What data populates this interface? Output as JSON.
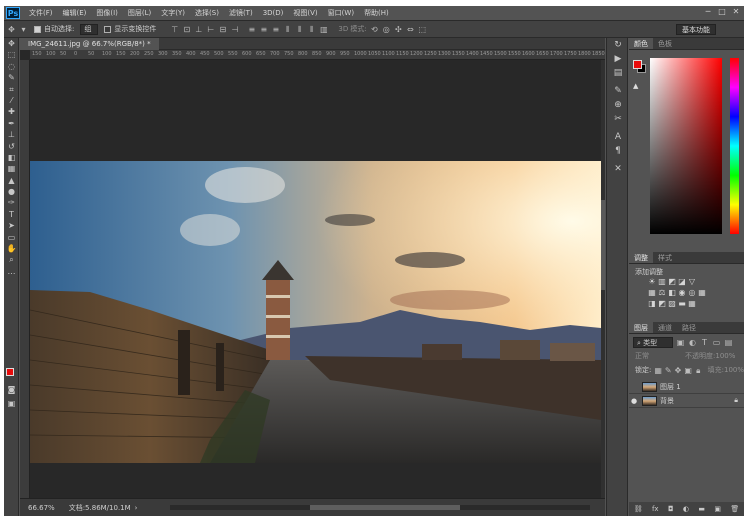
{
  "app": {
    "logo": "Ps"
  },
  "menu": [
    "文件(F)",
    "编辑(E)",
    "图像(I)",
    "图层(L)",
    "文字(Y)",
    "选择(S)",
    "滤镜(T)",
    "3D(D)",
    "视图(V)",
    "窗口(W)",
    "帮助(H)"
  ],
  "options": {
    "auto_select_label": "自动选择:",
    "auto_select_value": "组",
    "show_transform_label": "显示变换控件",
    "mode_3d_label": "3D 模式:",
    "workspace_label": "基本功能"
  },
  "document": {
    "tab_title": "IMG_24611.jpg @ 66.7%(RGB/8*) *",
    "zoom": "66.67%",
    "doc_info": "文档:5.86M/10.1M",
    "ruler_ticks": [
      "150",
      "100",
      "50",
      "0",
      "50",
      "100",
      "150",
      "200",
      "250",
      "300",
      "350",
      "400",
      "450",
      "500",
      "550",
      "600",
      "650",
      "700",
      "750",
      "800",
      "850",
      "900",
      "950",
      "1000",
      "1050",
      "1100",
      "1150",
      "1200",
      "1250",
      "1300",
      "1350",
      "1400",
      "1450",
      "1500",
      "1550",
      "1600",
      "1650",
      "1700",
      "1750",
      "1800",
      "1850",
      "1900"
    ]
  },
  "color_panel": {
    "tab_color": "颜色",
    "tab_swatches": "色板",
    "fg_color": "#e80c0c",
    "bg_color": "#000000"
  },
  "adjustments_panel": {
    "tab_adjustments": "调整",
    "tab_styles": "样式",
    "add_adjustment": "添加调整"
  },
  "layers_panel": {
    "tab_layers": "图层",
    "tab_channels": "通道",
    "tab_paths": "路径",
    "filter_kind": "类型",
    "blend_mode": "正常",
    "opacity_label": "不透明度:",
    "opacity_value": "100%",
    "lock_label": "锁定:",
    "fill_label": "填充:",
    "fill_value": "100%",
    "layers": [
      {
        "name": "图层 1",
        "visible": false
      },
      {
        "name": "背景",
        "visible": true
      }
    ]
  }
}
